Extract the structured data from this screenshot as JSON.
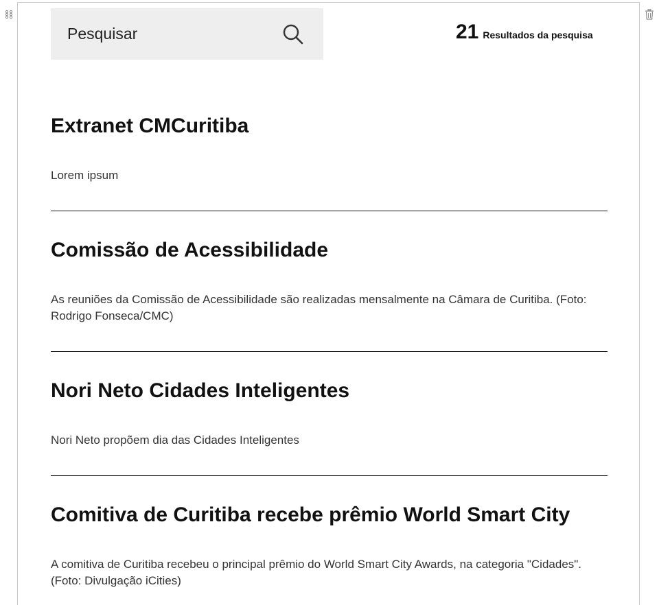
{
  "search": {
    "placeholder": "Pesquisar",
    "value": ""
  },
  "results_summary": {
    "count": "21",
    "label": "Resultados da pesquisa"
  },
  "results": [
    {
      "title": "Extranet CMCuritiba",
      "description": "Lorem ipsum"
    },
    {
      "title": "Comissão de Acessibilidade",
      "description": "As reuniões da Comissão de Acessibilidade são realizadas mensalmente na Câmara de Curitiba. (Foto: Rodrigo Fonseca/CMC)"
    },
    {
      "title": "Nori Neto Cidades Inteligentes",
      "description": "Nori Neto propõem dia das Cidades Inteligentes"
    },
    {
      "title": "Comitiva de Curitiba recebe prêmio World Smart City",
      "description": "A comitiva de Curitiba recebeu o principal prêmio do World Smart City Awards, na categoria \"Cidades\". (Foto: Divulgação iCities)"
    }
  ],
  "colors": {
    "frame_border": "#a8d8dc",
    "search_background": "#eeeeee",
    "text": "#111111"
  },
  "icons": {
    "drag": "drag-handle-icon",
    "delete": "trash-icon",
    "search": "search-icon"
  }
}
